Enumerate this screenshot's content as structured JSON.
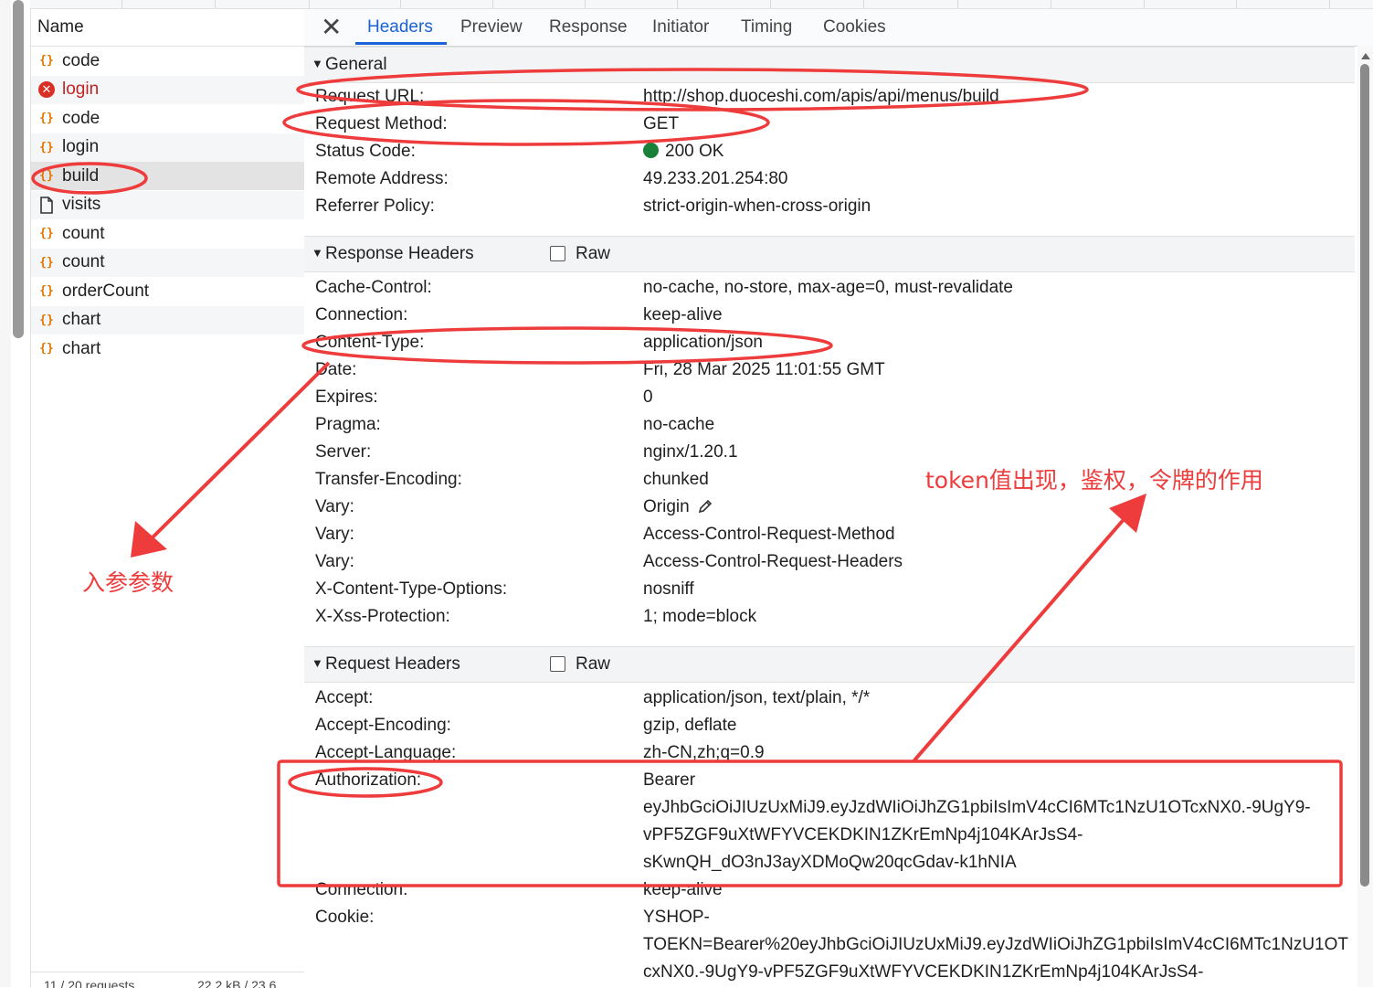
{
  "request_list": {
    "header": "Name",
    "items": [
      {
        "name": "code",
        "icon": "fetch-braces-icon",
        "state": "normal"
      },
      {
        "name": "login",
        "icon": "error-icon",
        "state": "error"
      },
      {
        "name": "code",
        "icon": "fetch-braces-icon",
        "state": "normal"
      },
      {
        "name": "login",
        "icon": "fetch-braces-icon",
        "state": "normal"
      },
      {
        "name": "build",
        "icon": "fetch-braces-icon",
        "state": "selected"
      },
      {
        "name": "visits",
        "icon": "document-icon",
        "state": "normal"
      },
      {
        "name": "count",
        "icon": "fetch-braces-icon",
        "state": "normal"
      },
      {
        "name": "count",
        "icon": "fetch-braces-icon",
        "state": "normal"
      },
      {
        "name": "orderCount",
        "icon": "fetch-braces-icon",
        "state": "normal"
      },
      {
        "name": "chart",
        "icon": "fetch-braces-icon",
        "state": "normal"
      },
      {
        "name": "chart",
        "icon": "fetch-braces-icon",
        "state": "normal"
      }
    ],
    "icon_glyph": "{}",
    "error_glyph": "✕",
    "footer_requests": "11 / 20 requests",
    "footer_transferred": "22.2 kB / 23.6"
  },
  "tabs": {
    "close": "✕",
    "items": [
      "Headers",
      "Preview",
      "Response",
      "Initiator",
      "Timing",
      "Cookies"
    ],
    "active": "Headers"
  },
  "general": {
    "title": "General",
    "rows": [
      {
        "key": "Request URL:",
        "value": "http://shop.duoceshi.com/apis/api/menus/build"
      },
      {
        "key": "Request Method:",
        "value": "GET"
      },
      {
        "key": "Status Code:",
        "value": "200 OK"
      },
      {
        "key": "Remote Address:",
        "value": "49.233.201.254:80"
      },
      {
        "key": "Referrer Policy:",
        "value": "strict-origin-when-cross-origin"
      }
    ]
  },
  "response_headers": {
    "title": "Response Headers",
    "raw_label": "Raw",
    "rows": [
      {
        "key": "Cache-Control:",
        "value": "no-cache, no-store, max-age=0, must-revalidate"
      },
      {
        "key": "Connection:",
        "value": "keep-alive"
      },
      {
        "key": "Content-Type:",
        "value": "application/json"
      },
      {
        "key": "Date:",
        "value": "Fri, 28 Mar 2025 11:01:55 GMT"
      },
      {
        "key": "Expires:",
        "value": "0"
      },
      {
        "key": "Pragma:",
        "value": "no-cache"
      },
      {
        "key": "Server:",
        "value": "nginx/1.20.1"
      },
      {
        "key": "Transfer-Encoding:",
        "value": "chunked"
      },
      {
        "key": "Vary:",
        "value": "Origin"
      },
      {
        "key": "Vary:",
        "value": "Access-Control-Request-Method"
      },
      {
        "key": "Vary:",
        "value": "Access-Control-Request-Headers"
      },
      {
        "key": "X-Content-Type-Options:",
        "value": "nosniff"
      },
      {
        "key": "X-Xss-Protection:",
        "value": "1; mode=block"
      }
    ]
  },
  "request_headers": {
    "title": "Request Headers",
    "raw_label": "Raw",
    "rows": [
      {
        "key": "Accept:",
        "value": "application/json, text/plain, */*"
      },
      {
        "key": "Accept-Encoding:",
        "value": "gzip, deflate"
      },
      {
        "key": "Accept-Language:",
        "value": "zh-CN,zh;q=0.9"
      },
      {
        "key": "Authorization:",
        "lines": [
          "Bearer",
          "eyJhbGciOiJIUzUxMiJ9.eyJzdWIiOiJhZG1pbiIsImV4cCI6MTc1NzU1OTcxNX0.-9UgY9-",
          "vPF5ZGF9uXtWFYVCEKDKIN1ZKrEmNp4j104KArJsS4-",
          "sKwnQH_dO3nJ3ayXDMoQw20qcGdav-k1hNIA"
        ]
      },
      {
        "key": "Connection:",
        "value": "keep-alive"
      },
      {
        "key": "Cookie:",
        "lines": [
          "YSHOP-",
          "TOEKN=Bearer%20eyJhbGciOiJIUzUxMiJ9.eyJzdWIiOiJhZG1pbiIsImV4cCI6MTc1NzU1OT",
          "cxNX0.-9UgY9-vPF5ZGF9uXtWFYVCEKDKIN1ZKrEmNp4j104KArJsS4-"
        ]
      }
    ]
  },
  "annotations": {
    "params_label": "入参参数",
    "token_label": "token值出现，鉴权，令牌的作用",
    "color": "#ee3b3b"
  },
  "colors": {
    "accent_blue": "#1a62d6",
    "status_green": "#188038",
    "error_red": "#c5221f",
    "icon_orange": "#e37400"
  }
}
